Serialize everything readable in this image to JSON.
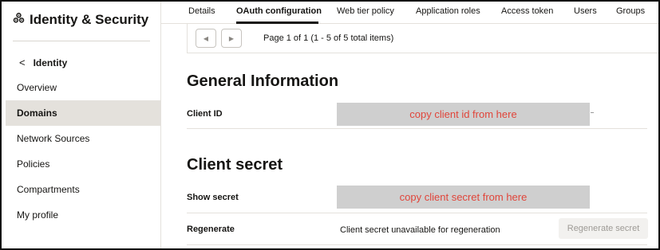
{
  "sidebar": {
    "title": "Identity & Security",
    "title_icon": "gears-icon",
    "back_label": "Identity",
    "back_icon": "chevron-left-icon",
    "items": [
      {
        "label": "Overview",
        "active": false
      },
      {
        "label": "Domains",
        "active": true
      },
      {
        "label": "Network Sources",
        "active": false
      },
      {
        "label": "Policies",
        "active": false
      },
      {
        "label": "Compartments",
        "active": false
      },
      {
        "label": "My profile",
        "active": false
      }
    ]
  },
  "tabs": [
    {
      "label": "Details",
      "active": false
    },
    {
      "label": "OAuth configuration",
      "active": true
    },
    {
      "label": "Web tier policy",
      "active": false
    },
    {
      "label": "Application roles",
      "active": false
    },
    {
      "label": "Access token",
      "active": false
    },
    {
      "label": "Users",
      "active": false
    },
    {
      "label": "Groups",
      "active": false
    }
  ],
  "pager": {
    "text": "Page 1 of 1 (1 - 5 of 5 total items)",
    "prev_icon": "caret-left-icon",
    "next_icon": "caret-right-icon"
  },
  "general": {
    "heading": "General Information",
    "client_id_label": "Client ID",
    "client_id_note": "copy client id from here"
  },
  "secret": {
    "heading": "Client secret",
    "show_label": "Show secret",
    "show_note": "copy client secret from here",
    "regen_label": "Regenerate",
    "regen_text": "Client secret unavailable for regeneration",
    "regen_button": "Regenerate secret"
  },
  "colors": {
    "annotation_text": "#e0453a",
    "redaction_fill": "#cfcfcf",
    "active_nav": "#e4e1dc"
  }
}
